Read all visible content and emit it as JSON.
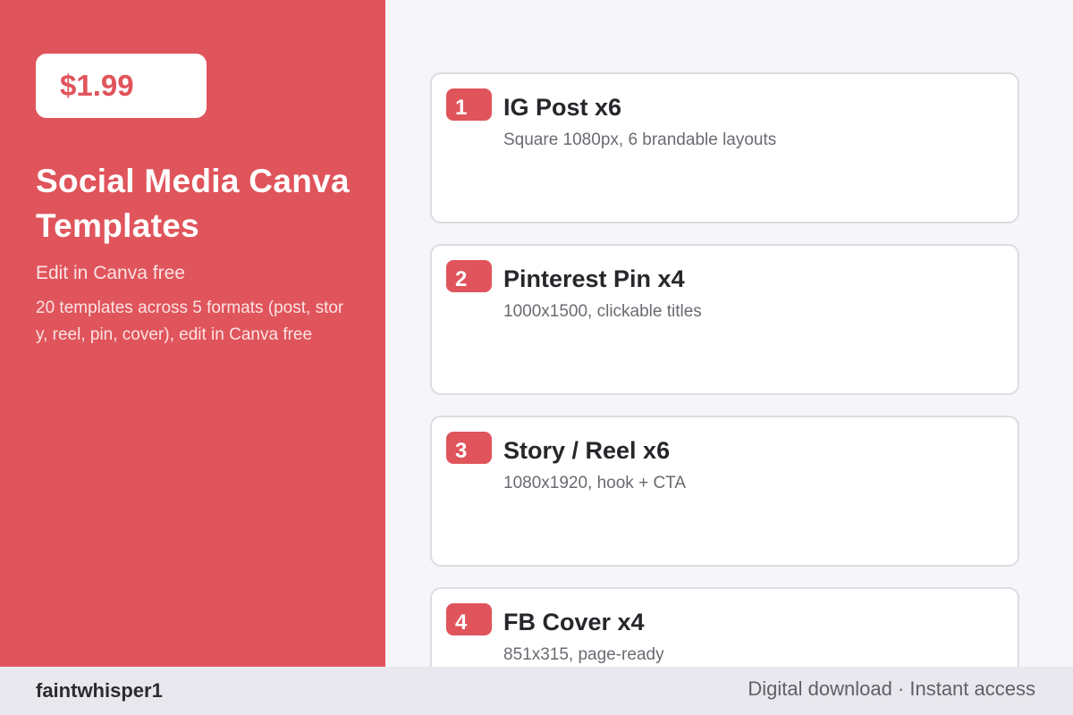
{
  "hero": {
    "price": "$1.99",
    "title": "Social Media Canva Templates",
    "subtitle": "Edit in Canva free",
    "description": "20 templates across 5 formats (post, story, reel, pin, cover), edit in Canva free"
  },
  "items": [
    {
      "number": "1",
      "title": "IG Post x6",
      "description": "Square 1080px, 6 brandable layouts"
    },
    {
      "number": "2",
      "title": "Pinterest Pin x4",
      "description": "1000x1500, clickable titles"
    },
    {
      "number": "3",
      "title": "Story / Reel x6",
      "description": "1080x1920, hook + CTA"
    },
    {
      "number": "4",
      "title": "FB Cover x4",
      "description": "851x315, page-ready"
    }
  ],
  "footer": {
    "seller": "faintwhisper1",
    "tagline": "Digital download · Instant access"
  },
  "colors": {
    "accent": "#e0545b",
    "background": "#f6f6f9",
    "card": "#ffffff",
    "footer": "#e9e8ee"
  }
}
